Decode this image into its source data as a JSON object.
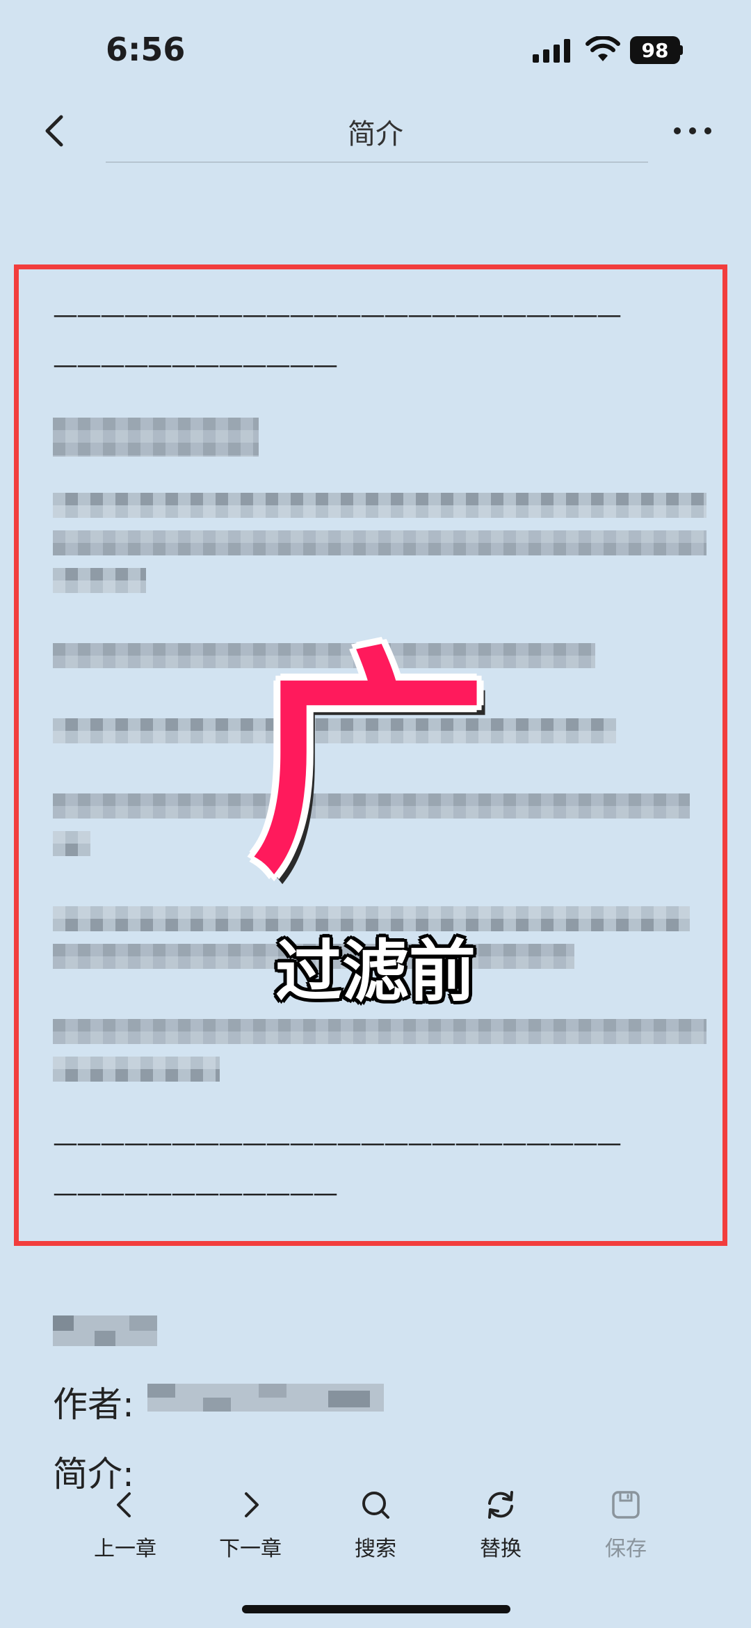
{
  "status_bar": {
    "time": "6:56",
    "battery": "98"
  },
  "nav": {
    "title": "简介",
    "back_icon": "chevron-left-icon",
    "more_icon": "more-horizontal-icon"
  },
  "content": {
    "divider_long": "————————————————————————",
    "divider_short": "————————————",
    "overlay_glyph": "广",
    "overlay_caption": "过滤前",
    "highlight_color": "#f23d3d",
    "glyph_color": "#ff1a5c"
  },
  "book_info": {
    "author_label": "作者:",
    "intro_label": "简介:"
  },
  "toolbar": {
    "items": [
      {
        "label": "上一章",
        "icon": "chevron-left-icon"
      },
      {
        "label": "下一章",
        "icon": "chevron-right-icon"
      },
      {
        "label": "搜索",
        "icon": "search-icon"
      },
      {
        "label": "替换",
        "icon": "refresh-icon"
      },
      {
        "label": "保存",
        "icon": "save-icon"
      }
    ]
  },
  "colors": {
    "background": "#d2e3f1",
    "text": "#1d1d1f"
  }
}
